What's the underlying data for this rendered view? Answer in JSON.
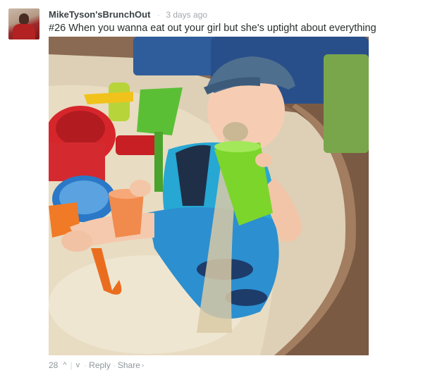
{
  "comment": {
    "username": "MikeTyson'sBrunchOut",
    "timestamp": "3 days ago",
    "text": "#26 When you wanna eat out your girl but she's uptight about everything",
    "image": {
      "alt_icon": "photo-baby-sandbox"
    },
    "footer": {
      "vote_count": "28",
      "upvote_icon": "^",
      "downvote_icon": "v",
      "separator": "·",
      "reply_label": "Reply",
      "share_label": "Share",
      "share_chevron": "›"
    }
  },
  "colors": {
    "username": "#3a4246",
    "meta": "#a1a9ac",
    "text": "#2a2e2e"
  }
}
